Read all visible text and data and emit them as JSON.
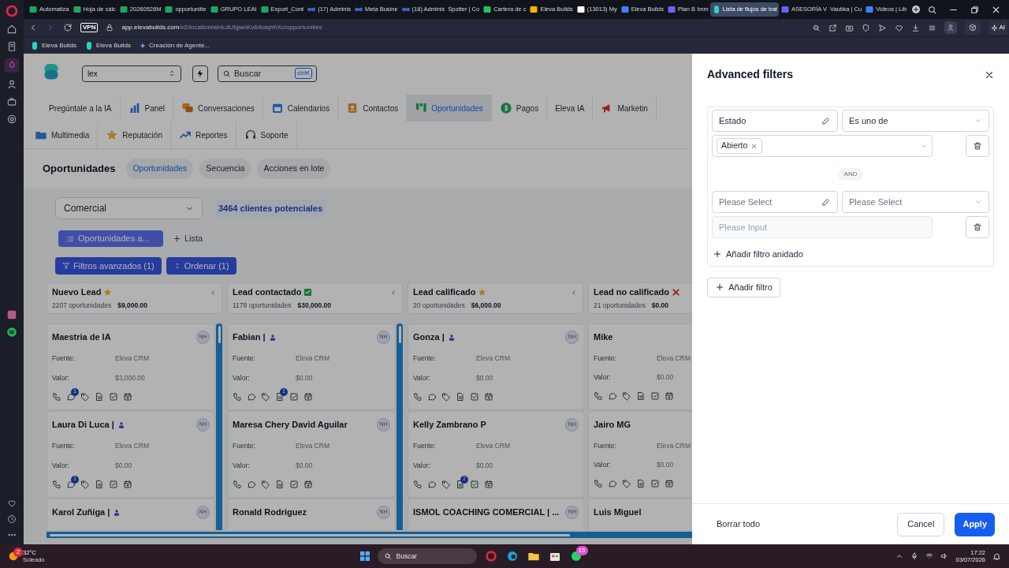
{
  "browser": {
    "tabs": [
      {
        "title": "Automatiza",
        "kind": "sheets",
        "selected": false
      },
      {
        "title": "Hoja de cálc",
        "kind": "sheets",
        "selected": false
      },
      {
        "title": "20260528M",
        "kind": "sheets",
        "selected": false
      },
      {
        "title": "opportunitie",
        "kind": "sheets",
        "selected": false
      },
      {
        "title": "GRUPO LEAI",
        "kind": "sheets",
        "selected": false
      },
      {
        "title": "Export_Cont",
        "kind": "sheets",
        "selected": false
      },
      {
        "title": "(17) Adminis",
        "kind": "meta",
        "selected": false
      },
      {
        "title": "Meta Busine",
        "kind": "meta",
        "selected": false
      },
      {
        "title": "(18) Adminis",
        "kind": "meta",
        "selected": false
      },
      {
        "title": "Spotter | Co",
        "kind": "none",
        "selected": false
      },
      {
        "title": "Cartera de c",
        "kind": "ring",
        "selected": false
      },
      {
        "title": "Eleva Builds",
        "kind": "drive",
        "selected": false
      },
      {
        "title": "(13013) My",
        "kind": "m",
        "selected": false
      },
      {
        "title": "Eleva Builds",
        "kind": "blue",
        "selected": false
      },
      {
        "title": "Plan B Imm",
        "kind": "purple",
        "selected": false
      },
      {
        "title": "Lista de flujos de trat",
        "kind": "eleva",
        "selected": true
      },
      {
        "title": "ASESORÍA V",
        "kind": "shield",
        "selected": false
      },
      {
        "title": "Vautika | Cu",
        "kind": "none",
        "selected": false
      },
      {
        "title": "Videos | Lib",
        "kind": "blue",
        "selected": false
      }
    ],
    "url_host": "app.elevabuilds.com",
    "url_path": "/v2/location/wHLdUIgwnKv64otqhhXc/opportunities",
    "vpn": "VPN",
    "bookmarks": [
      {
        "title": "Eleva Builds",
        "kind": "eleva"
      },
      {
        "title": "Eleva Builds",
        "kind": "eleva"
      },
      {
        "title": "Creación de Agente...",
        "kind": "spark"
      }
    ],
    "toolbar_ai": "AI"
  },
  "crm": {
    "location": "lex",
    "search_placeholder": "Buscar",
    "shortcut": "ctrlK",
    "nav": [
      {
        "label": "Pregúntale a la IA",
        "kind": "none",
        "selected": false
      },
      {
        "label": "Panel",
        "kind": "bars",
        "selected": false
      },
      {
        "label": "Conversaciones",
        "kind": "chat",
        "selected": false
      },
      {
        "label": "Calendarios",
        "kind": "calendar",
        "selected": false
      },
      {
        "label": "Contactos",
        "kind": "contact",
        "selected": false
      },
      {
        "label": "Oportunidades",
        "kind": "kanban",
        "selected": true
      },
      {
        "label": "Pagos",
        "kind": "dollar",
        "selected": false
      },
      {
        "label": "Eleva IA",
        "kind": "none",
        "selected": false
      },
      {
        "label": "Marketin",
        "kind": "megaphone",
        "selected": false
      }
    ],
    "nav_row2": [
      {
        "label": "Multimedia",
        "kind": "folder",
        "selected": false
      },
      {
        "label": "Reputación",
        "kind": "star",
        "selected": false
      },
      {
        "label": "Reportes",
        "kind": "trend",
        "selected": false
      },
      {
        "label": "Soporte",
        "kind": "headset",
        "selected": false
      }
    ],
    "page_title": "Oportunidades",
    "subtabs": [
      {
        "label": "Oportunidades",
        "selected": true
      },
      {
        "label": "Secuencia",
        "selected": false
      },
      {
        "label": "Acciones en lote",
        "selected": false
      }
    ],
    "pipeline": "Comercial",
    "leads_count": "3464 clientes potenciales",
    "view_button": "Oportunidades a...",
    "add_list": "Lista",
    "filter_button": "Filtros avanzados (1)",
    "sort_button": "Ordenar (1)",
    "columns": [
      {
        "name": "Nuevo Lead",
        "kind": "star",
        "count": "2207 oportunidades",
        "total": "$9,000.00",
        "cards": [
          {
            "name": "Maestria de IA",
            "tag": false,
            "avatar": "NH",
            "source_label": "Fuente:",
            "source": "Eleva CRM",
            "value_label": "Valor:",
            "value": "$3,000.00",
            "badge": {
              "kind": "chat",
              "count": "1"
            }
          },
          {
            "name": "Laura Di Luca |",
            "tag": true,
            "avatar": "NH",
            "source_label": "Fuente:",
            "source": "Eleva CRM",
            "value_label": "Valor:",
            "value": "$0.00",
            "badge": {
              "kind": "chat",
              "count": "1"
            }
          },
          {
            "name": "Karol Zuñiga |",
            "tag": true,
            "avatar": "NH"
          }
        ]
      },
      {
        "name": "Lead contactado",
        "kind": "check",
        "count": "1178 oportunidades",
        "total": "$30,000.00",
        "cards": [
          {
            "name": "Fabian |",
            "tag": true,
            "avatar": "NH",
            "source_label": "Fuente:",
            "source": "Eleva CRM",
            "value_label": "Valor:",
            "value": "$0.00",
            "badge": {
              "kind": "doc",
              "count": "1"
            }
          },
          {
            "name": "Maresa Chery David Aguilar",
            "tag": false,
            "avatar": "NH",
            "source_label": "Fuente:",
            "source": "Eleva CRM",
            "value_label": "Valor:",
            "value": "$0.00"
          },
          {
            "name": "Ronald Rodriguez",
            "tag": false,
            "avatar": "NH"
          }
        ]
      },
      {
        "name": "Lead calificado",
        "kind": "star",
        "count": "20 oportunidades",
        "total": "$6,000.00",
        "cards": [
          {
            "name": "Gonza |",
            "tag": true,
            "avatar": "NH",
            "source_label": "Fuente:",
            "source": "Eleva CRM",
            "value_label": "Valor:",
            "value": "$0.00"
          },
          {
            "name": "Kelly Zambrano P",
            "tag": false,
            "avatar": "NH",
            "source_label": "Fuente:",
            "source": "Eleva CRM",
            "value_label": "Valor:",
            "value": "$0.00",
            "badge": {
              "kind": "doc",
              "count": "2"
            }
          },
          {
            "name": "ISMOL COACHING COMERCIAL | ...",
            "tag": false,
            "avatar": "NH"
          }
        ]
      },
      {
        "name": "Lead no calificado",
        "kind": "cross",
        "count": "21 oportunidades",
        "total": "$0.00",
        "cards": [
          {
            "name": "Mike",
            "tag": false,
            "source_label": "Fuente:",
            "source": "Eleva CRM",
            "value_label": "Valor:",
            "value": "$0.00"
          },
          {
            "name": "Jairo MG",
            "tag": false,
            "source_label": "Fuente:",
            "source": "Eleva CRM",
            "value_label": "Valor:",
            "value": "$0.00"
          },
          {
            "name": "Luis Miguel",
            "tag": false
          }
        ]
      }
    ]
  },
  "drawer": {
    "title": "Advanced filters",
    "filters": [
      {
        "field": "Estado",
        "operator": "Es uno de",
        "values": [
          "Abierto"
        ]
      },
      {
        "field_placeholder": "Please Select",
        "operator_placeholder": "Please Select",
        "value_placeholder": "Please Input"
      }
    ],
    "connector": "AND",
    "add_nested": "Añadir filtro anidado",
    "add_filter": "Añadir filtro",
    "clear_all": "Borrar todo",
    "cancel": "Cancel",
    "apply": "Apply"
  },
  "taskbar": {
    "temperature": "32°C",
    "weather": "Soleado",
    "weather_badge": "2",
    "search_placeholder": "Buscar",
    "whatsapp_badge": "15",
    "time": "17:22",
    "date": "03/07/2026"
  }
}
